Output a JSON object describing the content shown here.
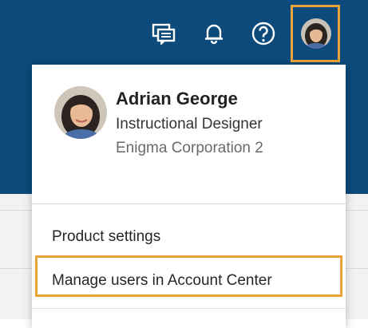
{
  "header": {
    "icons": [
      "chat-feedback-icon",
      "bell-icon",
      "help-icon"
    ],
    "background_color": "#0b4a7a",
    "highlight_color": "#e8a33a"
  },
  "profile_menu": {
    "name": "Adrian George",
    "role": "Instructional Designer",
    "organization": "Enigma Corporation 2",
    "items": [
      {
        "label": "Product settings"
      },
      {
        "label": "Manage users in Account Center",
        "highlighted": true
      }
    ]
  }
}
